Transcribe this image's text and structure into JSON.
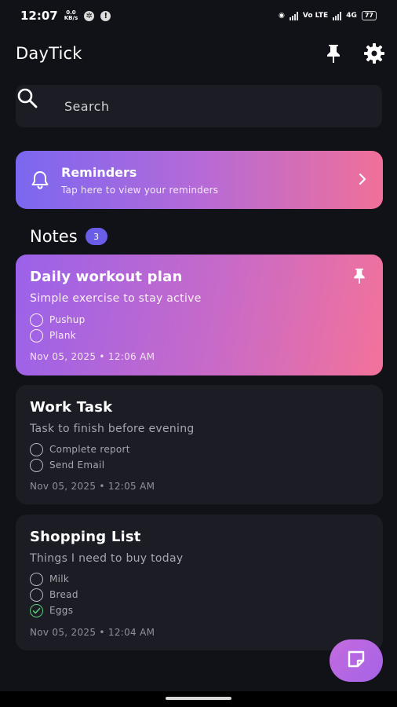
{
  "status": {
    "time": "12:07",
    "net_speed_top": "0.0",
    "net_speed_bottom": "KB/s",
    "vol_label": "Vo LTE",
    "lte_label": "4G",
    "battery": "77"
  },
  "header": {
    "title": "DayTick",
    "pin_icon": "pin-icon",
    "settings_icon": "gear-icon"
  },
  "search": {
    "placeholder": "Search",
    "icon": "search-icon"
  },
  "reminders": {
    "title": "Reminders",
    "subtitle": "Tap here to view your reminders",
    "icon": "bell-icon",
    "colors": [
      "#7b67f0",
      "#f07098"
    ]
  },
  "notes": {
    "label": "Notes",
    "count": "3",
    "items": [
      {
        "title": "Daily workout plan",
        "description": "Simple exercise to stay active",
        "pinned": true,
        "checklist": [
          {
            "text": "Pushup",
            "done": false
          },
          {
            "text": "Plank",
            "done": false
          }
        ],
        "date": "Nov 05, 2025 • 12:06 AM"
      },
      {
        "title": "Work Task",
        "description": "Task to finish before evening",
        "pinned": false,
        "checklist": [
          {
            "text": "Complete report",
            "done": false
          },
          {
            "text": "Send Email",
            "done": false
          }
        ],
        "date": "Nov 05, 2025 • 12:05 AM"
      },
      {
        "title": "Shopping List",
        "description": "Things I need to buy today",
        "pinned": false,
        "checklist": [
          {
            "text": "Milk",
            "done": false
          },
          {
            "text": "Bread",
            "done": false
          },
          {
            "text": "Eggs",
            "done": true
          }
        ],
        "date": "Nov 05, 2025 • 12:04 AM"
      }
    ]
  },
  "fab": {
    "icon": "note-add-icon"
  }
}
